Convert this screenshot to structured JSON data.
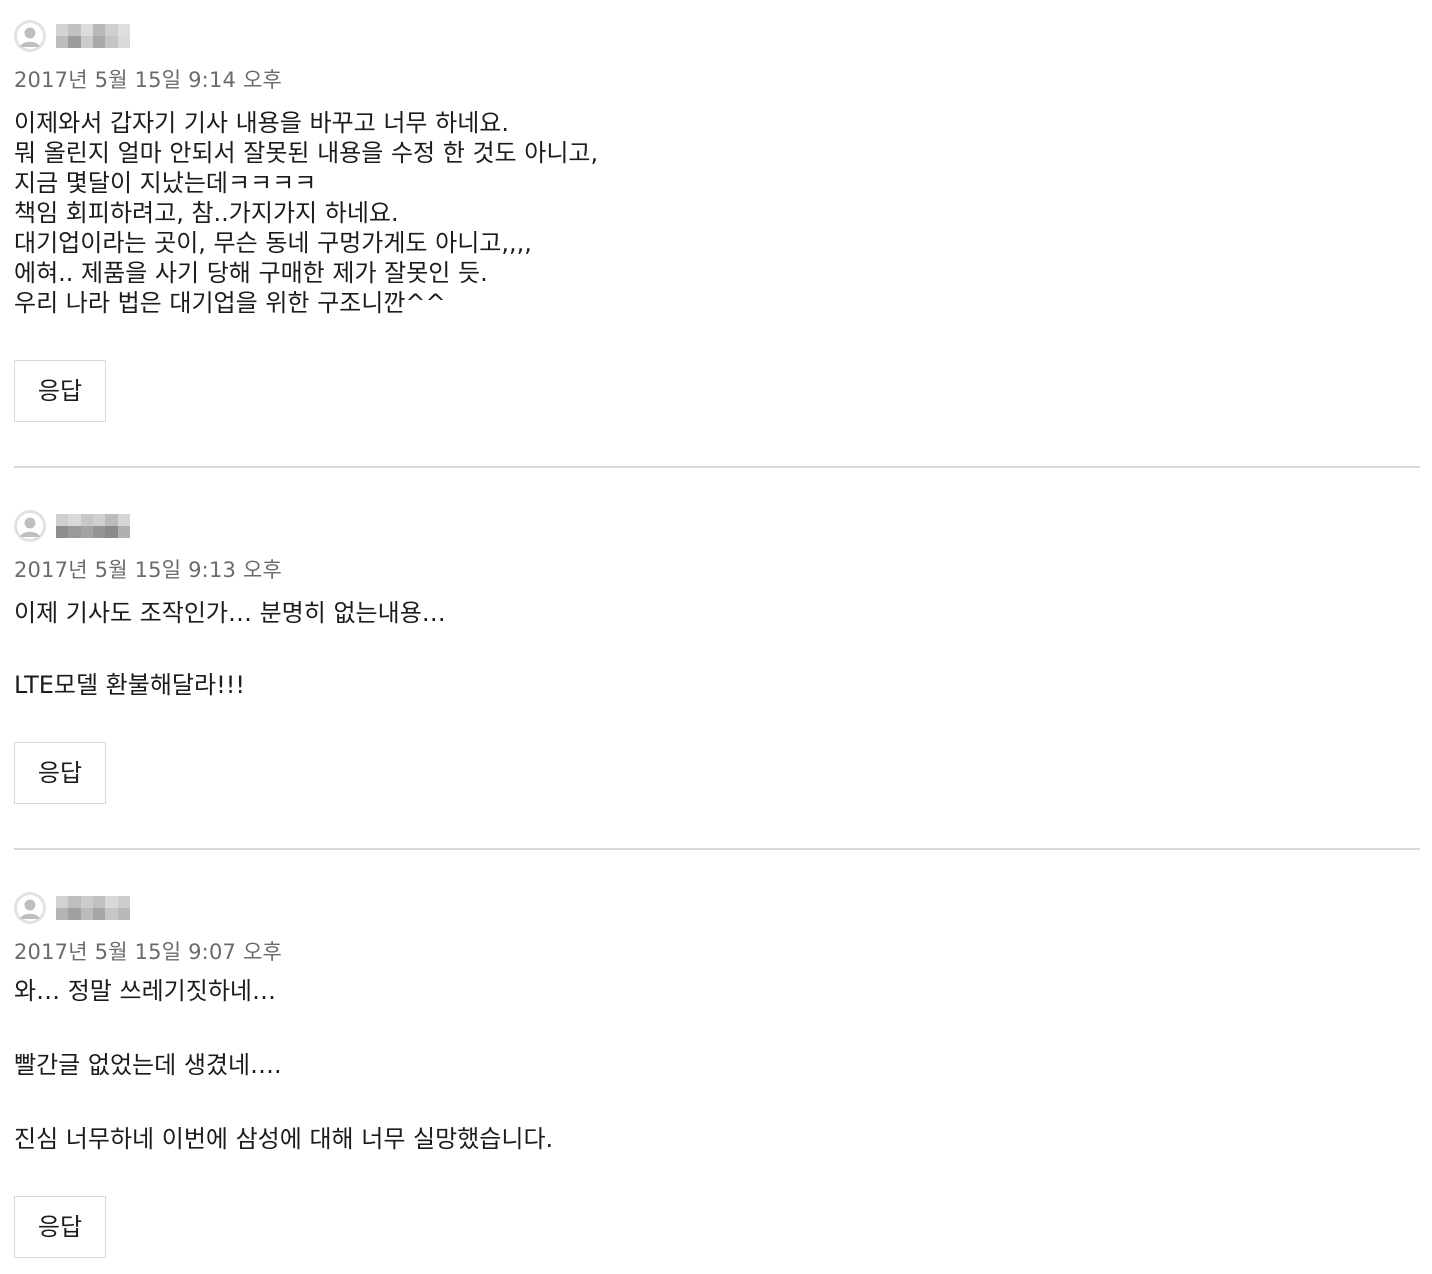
{
  "reply_label": "응답",
  "comments": [
    {
      "author": "",
      "date": "2017년 5월 15일 9:14 오후",
      "paragraphs": [
        "이제와서 갑자기 기사 내용을 바꾸고 너무 하네요.\n뭐 올린지 얼마 안되서 잘못된 내용을 수정 한 것도 아니고,\n지금 몇달이 지났는데ㅋㅋㅋㅋ\n책임 회피하려고, 참..가지가지 하네요.\n대기업이라는 곳이, 무슨 동네 구멍가게도 아니고,,,,\n에혀.. 제품을 사기 당해 구매한 제가 잘못인 듯.\n우리 나라 법은 대기업을 위한 구조니깐^^"
      ]
    },
    {
      "author": "",
      "date": "2017년 5월 15일 9:13 오후",
      "paragraphs": [
        "이제 기사도 조작인가… 분명히 없는내용…",
        "LTE모델 환불해달라!!!"
      ]
    },
    {
      "author": "",
      "date": "2017년 5월 15일 9:07 오후",
      "paragraphs": [
        "와… 정말 쓰레기짓하네…",
        "빨간글 없었는데 생겼네….",
        "진심 너무하네 이번에 삼성에 대해 너무 실망했습니다."
      ]
    }
  ]
}
